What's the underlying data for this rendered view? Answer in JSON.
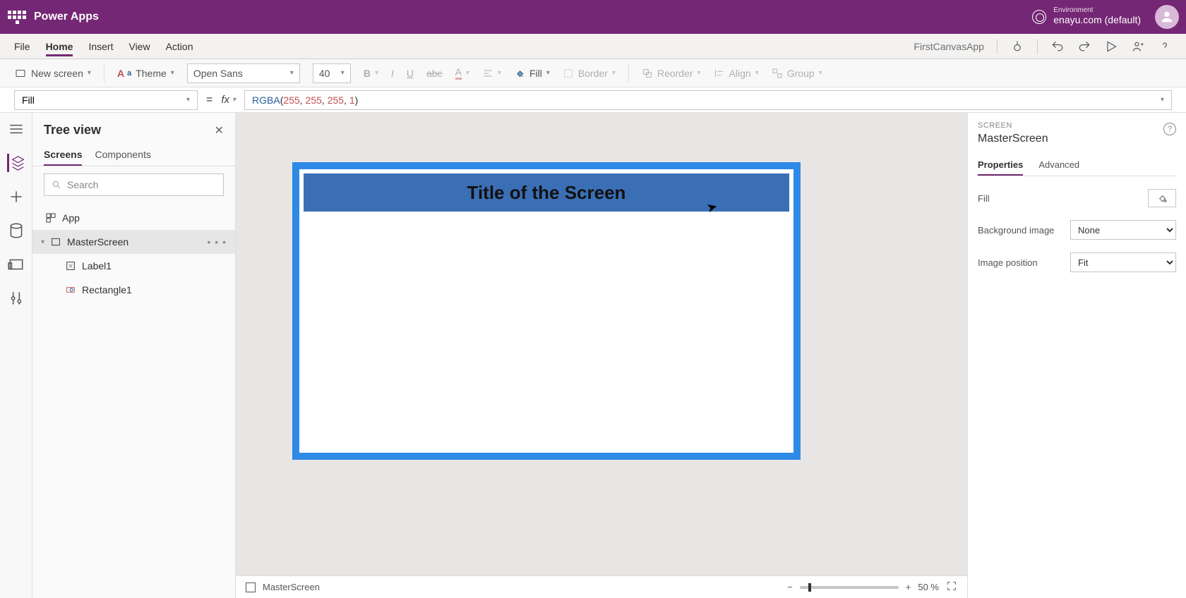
{
  "topbar": {
    "app_title": "Power Apps",
    "env_label": "Environment",
    "env_value": "enayu.com (default)"
  },
  "menu": {
    "items": [
      "File",
      "Home",
      "Insert",
      "View",
      "Action"
    ],
    "active": "Home",
    "app_name": "FirstCanvasApp"
  },
  "ribbon": {
    "new_screen": "New screen",
    "theme": "Theme",
    "font": "Open Sans",
    "size": "40",
    "fill": "Fill",
    "border": "Border",
    "reorder": "Reorder",
    "align": "Align",
    "group": "Group"
  },
  "formula": {
    "property": "Fill",
    "fx": "fx",
    "fn": "RGBA",
    "arg1": "255",
    "arg2": "255",
    "arg3": "255",
    "arg4": "1"
  },
  "tree": {
    "title": "Tree view",
    "tabs": [
      "Screens",
      "Components"
    ],
    "active_tab": "Screens",
    "search_placeholder": "Search",
    "items": {
      "app": "App",
      "screen": "MasterScreen",
      "label": "Label1",
      "rect": "Rectangle1"
    }
  },
  "canvas": {
    "title_text": "Title of the Screen"
  },
  "status": {
    "screen_name": "MasterScreen",
    "zoom": "50  %"
  },
  "props": {
    "heading": "SCREEN",
    "name": "MasterScreen",
    "tabs": [
      "Properties",
      "Advanced"
    ],
    "active_tab": "Properties",
    "fill_label": "Fill",
    "bg_label": "Background image",
    "bg_value": "None",
    "imgpos_label": "Image position",
    "imgpos_value": "Fit"
  }
}
